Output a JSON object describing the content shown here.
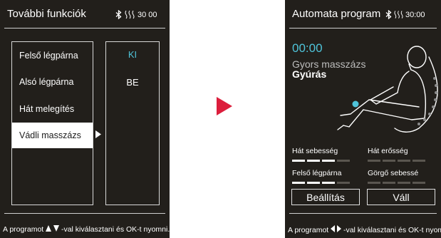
{
  "left_screen": {
    "title": "További funkciók",
    "status_time": "30 00",
    "menu": [
      "Felső légpárna",
      "Alsó légpárna",
      "Hát melegítés",
      "Vádli masszázs"
    ],
    "options": [
      "KI",
      "BE"
    ],
    "footer": {
      "before": "A programot",
      "after": "-val kiválasztani és OK-t nyomni."
    }
  },
  "right_screen": {
    "title": "Automata program",
    "status_time": "30:00",
    "timer": "00:00",
    "program_name": "Gyors masszázs",
    "program_sub": "Gyúrás",
    "levels": [
      {
        "label": "Hát sebesség",
        "value": 3,
        "max": 4
      },
      {
        "label": "Hát erősség",
        "value": 0,
        "max": 4
      },
      {
        "label": "Felső légpárna",
        "value": 3,
        "max": 4
      },
      {
        "label": "Görgő sebessé",
        "value": 0,
        "max": 4
      }
    ],
    "buttons": [
      "Beállítás",
      "Váll"
    ],
    "footer": {
      "before": "A programot",
      "after": "-val kiválasztani és OK-t nyomni"
    }
  },
  "colors": {
    "screen_bg": "#221f1b",
    "accent": "#4fc3d9",
    "arrow": "#dc1e3c"
  }
}
